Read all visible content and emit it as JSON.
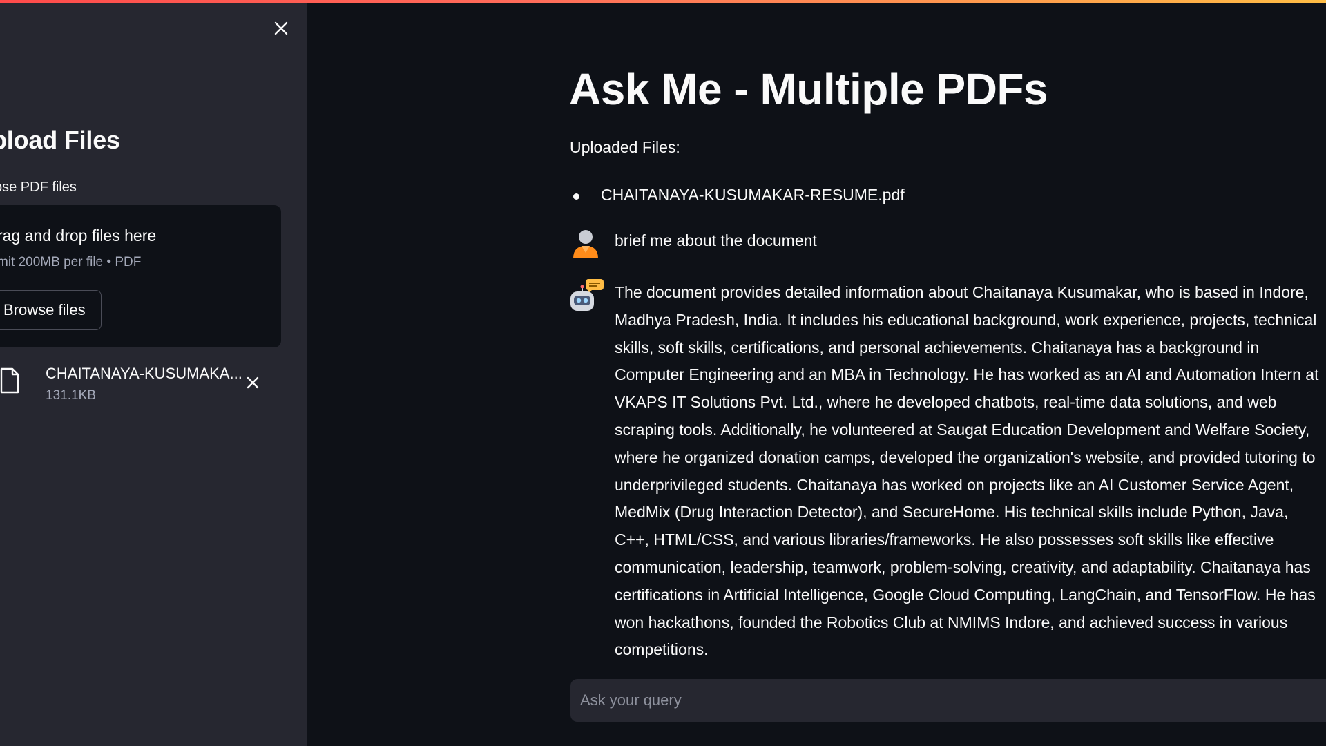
{
  "colors": {
    "background": "#0e1117",
    "sidebar_background": "#262730",
    "text": "#fafafa",
    "muted_text": "#a3a8b8",
    "accent_gradient_start": "#ff4b4b",
    "accent_gradient_end": "#ffbd45",
    "user_avatar": "#ff8c1a",
    "bot_avatar_bubble": "#ffbd45"
  },
  "sidebar": {
    "close_icon": "close-icon",
    "heading": "pload Files",
    "uploader_label": "ose PDF files",
    "dropzone": {
      "instructions": "rag and drop files here",
      "limit": "mit 200MB per file • PDF",
      "browse_label": "Browse files"
    },
    "files": [
      {
        "name": "CHAITANAYA-KUSUMAKA...",
        "size": "131.1KB",
        "icon": "file-icon",
        "remove_icon": "close-icon"
      }
    ]
  },
  "main": {
    "title": "Ask Me - Multiple PDFs",
    "uploaded_label": "Uploaded Files:",
    "uploaded_files": [
      "CHAITANAYA-KUSUMAKAR-RESUME.pdf"
    ],
    "messages": [
      {
        "role": "user",
        "avatar": "user-avatar-icon",
        "text": "brief me about the document"
      },
      {
        "role": "assistant",
        "avatar": "robot-avatar-icon",
        "text": "The document provides detailed information about Chaitanaya Kusumakar, who is based in Indore, Madhya Pradesh, India. It includes his educational background, work experience, projects, technical skills, soft skills, certifications, and personal achievements. Chaitanaya has a background in Computer Engineering and an MBA in Technology. He has worked as an AI and Automation Intern at VKAPS IT Solutions Pvt. Ltd., where he developed chatbots, real-time data solutions, and web scraping tools. Additionally, he volunteered at Saugat Education Development and Welfare Society, where he organized donation camps, developed the organization's website, and provided tutoring to underprivileged students. Chaitanaya has worked on projects like an AI Customer Service Agent, MedMix (Drug Interaction Detector), and SecureHome. His technical skills include Python, Java, C++, HTML/CSS, and various libraries/frameworks. He also possesses soft skills like effective communication, leadership, teamwork, problem-solving, creativity, and adaptability. Chaitanaya has certifications in Artificial Intelligence, Google Cloud Computing, LangChain, and TensorFlow. He has won hackathons, founded the Robotics Club at NMIMS Indore, and achieved success in various competitions."
      }
    ],
    "chat_input": {
      "placeholder": "Ask your query",
      "value": ""
    }
  }
}
